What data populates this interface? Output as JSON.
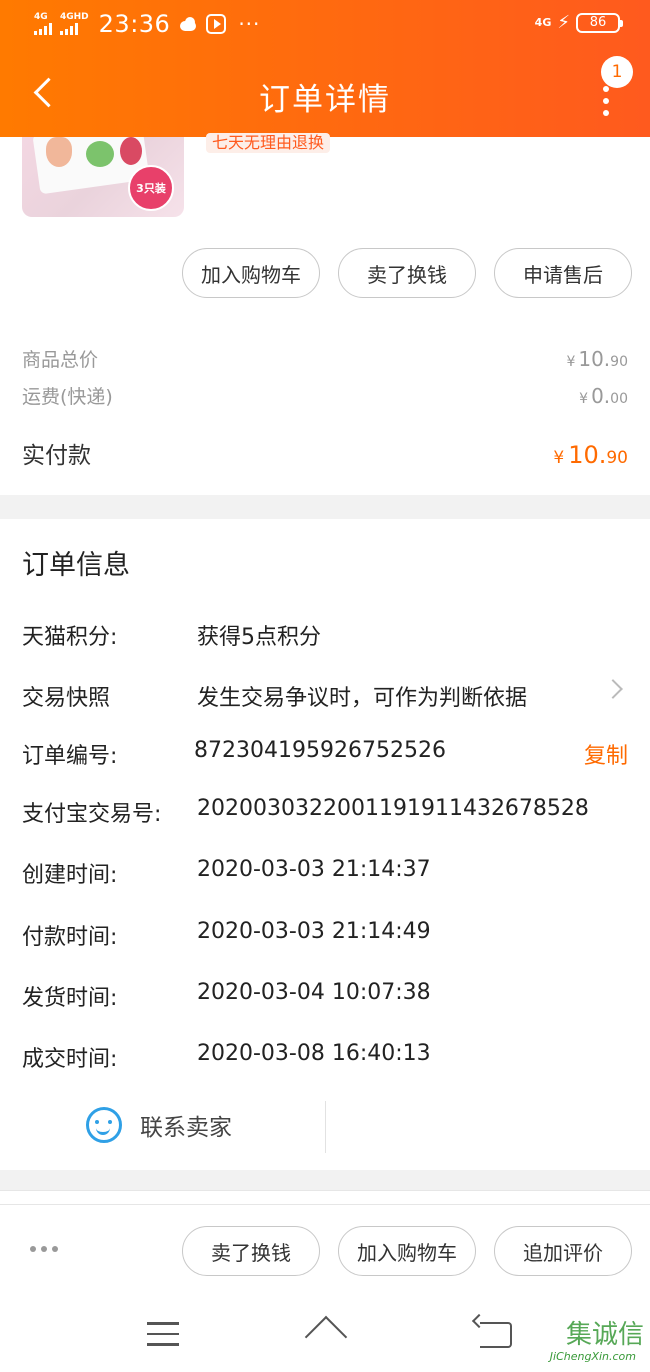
{
  "status_bar": {
    "network_1": "4G",
    "network_2": "4GHD",
    "time": "23:36",
    "more": "···",
    "network_right": "4G",
    "battery": "86"
  },
  "header": {
    "title": "订单详情",
    "badge_count": "1"
  },
  "product": {
    "pack_label": "3只装",
    "service_tag": "七天无理由退换",
    "actions": [
      "加入购物车",
      "卖了换钱",
      "申请售后"
    ]
  },
  "prices": {
    "goods_total_label": "商品总价",
    "goods_total_currency": "¥",
    "goods_total_int": "10.",
    "goods_total_dec": "90",
    "shipping_label": "运费(快递)",
    "shipping_currency": "¥",
    "shipping_int": "0.",
    "shipping_dec": "00",
    "paid_label": "实付款",
    "paid_currency": "¥",
    "paid_int": "10.",
    "paid_dec": "90"
  },
  "order_info": {
    "title": "订单信息",
    "rows": [
      {
        "key": "天猫积分:",
        "value": "获得5点积分"
      },
      {
        "key": "交易快照",
        "value": "发生交易争议时，可作为判断依据"
      },
      {
        "key": "订单编号:",
        "value": "872304195926752526"
      },
      {
        "key": "支付宝交易号:",
        "value": "2020030322001191911432678528"
      },
      {
        "key": "创建时间:",
        "value": "2020-03-03 21:14:37"
      },
      {
        "key": "付款时间:",
        "value": "2020-03-03 21:14:49"
      },
      {
        "key": "发货时间:",
        "value": "2020-03-04 10:07:38"
      },
      {
        "key": "成交时间:",
        "value": "2020-03-08 16:40:13"
      }
    ],
    "copy_label": "复制",
    "contact_seller": "联系卖家"
  },
  "bottom_bar": {
    "actions": [
      "卖了换钱",
      "加入购物车",
      "追加评价"
    ]
  },
  "watermark": {
    "logo_text": "集诚信",
    "url_text": "JiChengXin.com"
  },
  "colors": {
    "accent": "#ff6a00",
    "header_gradient_start": "#ff7a00",
    "header_gradient_end": "#ff5a1e",
    "chat_icon": "#2fa0e6"
  }
}
